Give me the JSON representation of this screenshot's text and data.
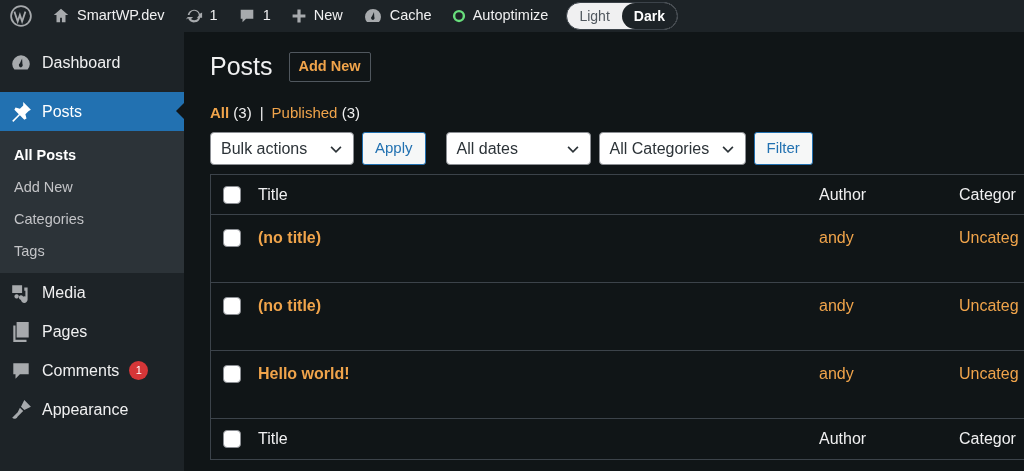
{
  "admin_bar": {
    "site": "SmartWP.dev",
    "updates": "1",
    "comments": "1",
    "new": "New",
    "cache": "Cache",
    "autoptimize": "Autoptimize",
    "theme_toggle": [
      {
        "label": "Light",
        "selected": false
      },
      {
        "label": "Dark",
        "selected": true
      }
    ]
  },
  "sidebar": {
    "items": [
      {
        "label": "Dashboard",
        "selected": false
      },
      {
        "label": "Posts",
        "selected": true,
        "children": [
          {
            "label": "All Posts",
            "selected": true
          },
          {
            "label": "Add New",
            "selected": false
          },
          {
            "label": "Categories",
            "selected": false
          },
          {
            "label": "Tags",
            "selected": false
          }
        ]
      },
      {
        "label": "Media",
        "selected": false
      },
      {
        "label": "Pages",
        "selected": false
      },
      {
        "label": "Comments",
        "selected": false,
        "badge": "1"
      },
      {
        "label": "Appearance",
        "selected": false
      }
    ]
  },
  "page": {
    "title": "Posts",
    "add_new": "Add New",
    "filter_separator": "|",
    "filters": [
      {
        "label": "All",
        "count": "(3)",
        "selected": true
      },
      {
        "label": "Published",
        "count": "(3)",
        "selected": false
      }
    ],
    "bulk_actions": "Bulk actions",
    "apply": "Apply",
    "dates": "All dates",
    "categories": "All Categories",
    "filter": "Filter"
  },
  "table": {
    "columns": [
      "Title",
      "Author",
      "Categor"
    ],
    "header_checked": false,
    "footer_checked": false,
    "rows": [
      {
        "title": "(no title)",
        "author": "andy",
        "category": "Uncateg",
        "checked": false
      },
      {
        "title": "(no title)",
        "author": "andy",
        "category": "Uncateg",
        "checked": false
      },
      {
        "title": "Hello world!",
        "author": "andy",
        "category": "Uncateg",
        "checked": false
      }
    ],
    "footer_columns": [
      "Title",
      "Author",
      "Categor"
    ]
  }
}
